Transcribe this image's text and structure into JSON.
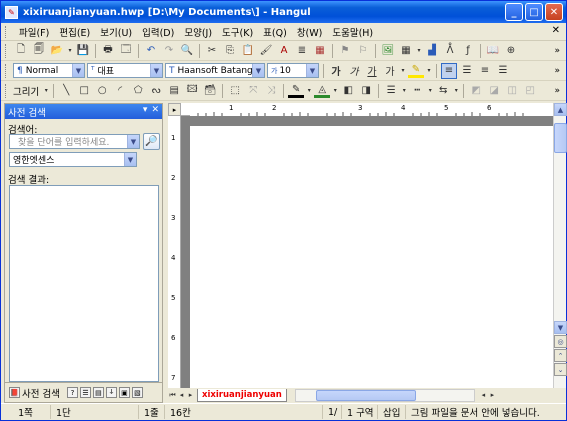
{
  "window": {
    "title": "xixiruanjianyuan.hwp  [D:\\My Documents\\] - Hangul"
  },
  "menu": [
    "파일(F)",
    "편집(E)",
    "보기(U)",
    "입력(D)",
    "모양(J)",
    "도구(K)",
    "표(Q)",
    "창(W)",
    "도움말(H)"
  ],
  "format_toolbar": {
    "style": "Normal",
    "font_group": "대표",
    "font": "Haansoft Batang",
    "size": "10",
    "bold": "가",
    "italic": "가",
    "underline": "가",
    "superscript": "가"
  },
  "draw_toolbar": {
    "label": "그리기"
  },
  "dictionary_panel": {
    "title": "사전 검색",
    "search_label": "검색어:",
    "search_placeholder": "찾을 단어를 입력하세요.",
    "dictionary": "영한엣센스",
    "results_label": "검색 결과:",
    "tab_label": "사전 검색"
  },
  "document": {
    "tab_name": "xixiruanjianyuan",
    "ruler_h": [
      "1",
      "2",
      "3",
      "4",
      "5",
      "6"
    ],
    "ruler_v": [
      "1",
      "2",
      "3",
      "4",
      "5",
      "6",
      "7"
    ]
  },
  "status": {
    "page": "1쪽",
    "section": "1단",
    "line": "1줄",
    "column": "16칸",
    "page_of": "1/",
    "area": "1 구역",
    "mode": "삽입",
    "message": "그림 파일을 문서 안에 넣습니다."
  }
}
